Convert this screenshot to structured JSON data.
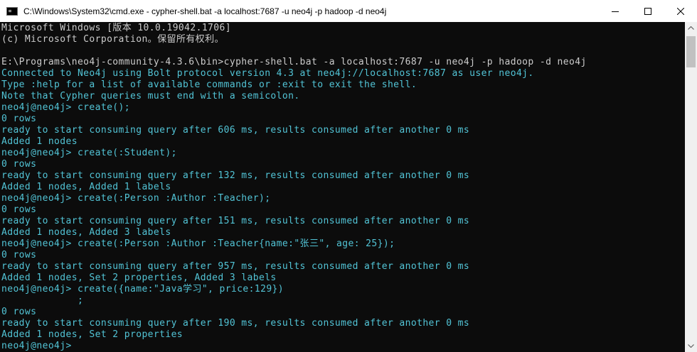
{
  "window": {
    "title": "C:\\Windows\\System32\\cmd.exe - cypher-shell.bat  -a localhost:7687 -u neo4j -p hadoop -d neo4j",
    "icon": "console-icon",
    "controls": [
      "minimize-icon",
      "maximize-icon",
      "close-icon"
    ]
  },
  "console": {
    "lines": [
      "Microsoft Windows [版本 10.0.19042.1706]",
      "(c) Microsoft Corporation。保留所有权利。",
      "",
      "E:\\Programs\\neo4j-community-4.3.6\\bin>cypher-shell.bat -a localhost:7687 -u neo4j -p hadoop -d neo4j",
      "Connected to Neo4j using Bolt protocol version 4.3 at neo4j://localhost:7687 as user neo4j.",
      "Type :help for a list of available commands or :exit to exit the shell.",
      "Note that Cypher queries must end with a semicolon.",
      "neo4j@neo4j> create();",
      "0 rows",
      "ready to start consuming query after 606 ms, results consumed after another 0 ms",
      "Added 1 nodes",
      "neo4j@neo4j> create(:Student);",
      "0 rows",
      "ready to start consuming query after 132 ms, results consumed after another 0 ms",
      "Added 1 nodes, Added 1 labels",
      "neo4j@neo4j> create(:Person :Author :Teacher);",
      "0 rows",
      "ready to start consuming query after 151 ms, results consumed after another 0 ms",
      "Added 1 nodes, Added 3 labels",
      "neo4j@neo4j> create(:Person :Author :Teacher{name:\"张三\", age: 25});",
      "0 rows",
      "ready to start consuming query after 957 ms, results consumed after another 0 ms",
      "Added 1 nodes, Set 2 properties, Added 3 labels",
      "neo4j@neo4j> create({name:\"Java学习\", price:129})",
      "             ;",
      "0 rows",
      "ready to start consuming query after 190 ms, results consumed after another 0 ms",
      "Added 1 nodes, Set 2 properties",
      "neo4j@neo4j>"
    ],
    "colors": {
      "background": "#0c0c0c",
      "system_text": "#cccccc",
      "shell_text": "#52c4d6"
    }
  },
  "scrollbar": {
    "up": "scroll-up-arrow-icon",
    "down": "scroll-down-arrow-icon",
    "position": 0.0
  }
}
